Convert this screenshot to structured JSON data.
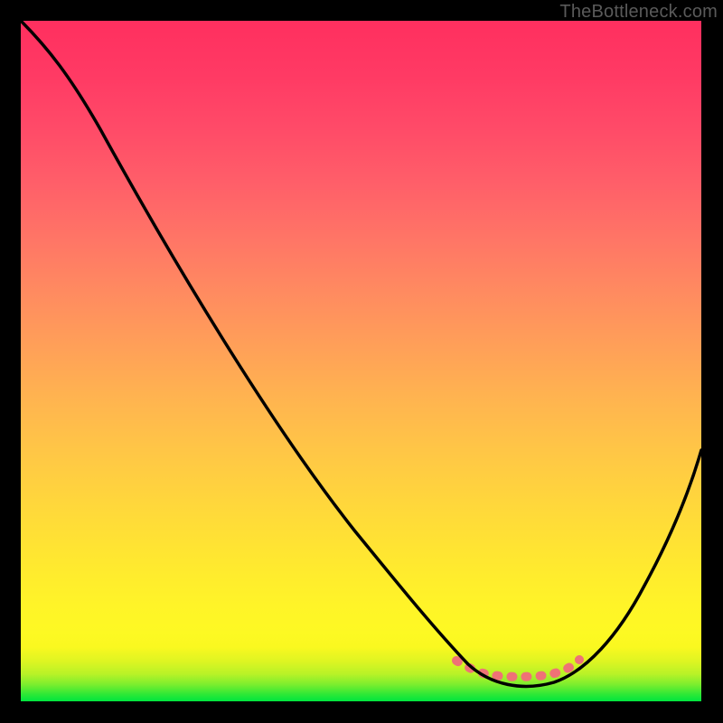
{
  "watermark": {
    "text": "TheBottleneck.com"
  },
  "chart_data": {
    "type": "line",
    "title": "",
    "xlabel": "",
    "ylabel": "",
    "xlim": [
      0,
      100
    ],
    "ylim": [
      0,
      100
    ],
    "grid": false,
    "series": [
      {
        "name": "main-curve",
        "x": [
          0,
          5,
          10,
          20,
          30,
          40,
          50,
          58,
          64,
          74,
          82,
          89,
          100
        ],
        "values": [
          100,
          97,
          92.5,
          80,
          65.5,
          50,
          34,
          19,
          7,
          3,
          6,
          16,
          37
        ]
      },
      {
        "name": "bottom-band",
        "x": [
          64,
          66,
          68,
          69,
          70,
          72,
          75,
          79,
          80,
          81,
          82
        ],
        "values": [
          6,
          5.2,
          4.6,
          4.4,
          4.3,
          4.1,
          4.0,
          4.4,
          4.7,
          5.2,
          6.2
        ]
      }
    ]
  }
}
